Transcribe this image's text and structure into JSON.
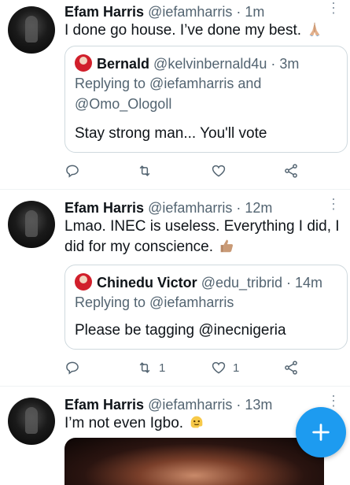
{
  "tweets": [
    {
      "name": "Efam Harris",
      "handle": "@iefamharris · 1m",
      "text": "I done go house. I’ve done my best.",
      "emoji": "folded-hands",
      "quote": {
        "name": "Bernald",
        "handle": "@kelvinbernald4u · 3m",
        "reply_line1": "Replying to @iefamharris and",
        "reply_line2": "@Omo_Ologoll",
        "text": "Stay strong man... You'll vote"
      },
      "actions": {
        "reply_count": "",
        "retweet_count": "",
        "like_count": ""
      }
    },
    {
      "name": "Efam Harris",
      "handle": "@iefamharris · 12m",
      "text_line1": "Lmao. INEC is useless. Everything I did, I",
      "text_line2": "did for my conscience.",
      "emoji": "thumbs-up",
      "quote": {
        "name": "Chinedu Victor",
        "handle": "@edu_tribrid · 14m",
        "reply_line1": "Replying to @iefamharris",
        "text": "Please be tagging @inecnigeria"
      },
      "actions": {
        "reply_count": "",
        "retweet_count": "1",
        "like_count": "1"
      }
    },
    {
      "name": "Efam Harris",
      "handle": "@iefamharris · 13m",
      "text": "I’m not even Igbo.",
      "emoji": "melting-face"
    }
  ],
  "colors": {
    "accent": "#1d9bf0",
    "text": "#0f1419",
    "secondary": "#536471",
    "border": "#cfd9de"
  },
  "fab": {
    "icon": "plus-icon"
  }
}
